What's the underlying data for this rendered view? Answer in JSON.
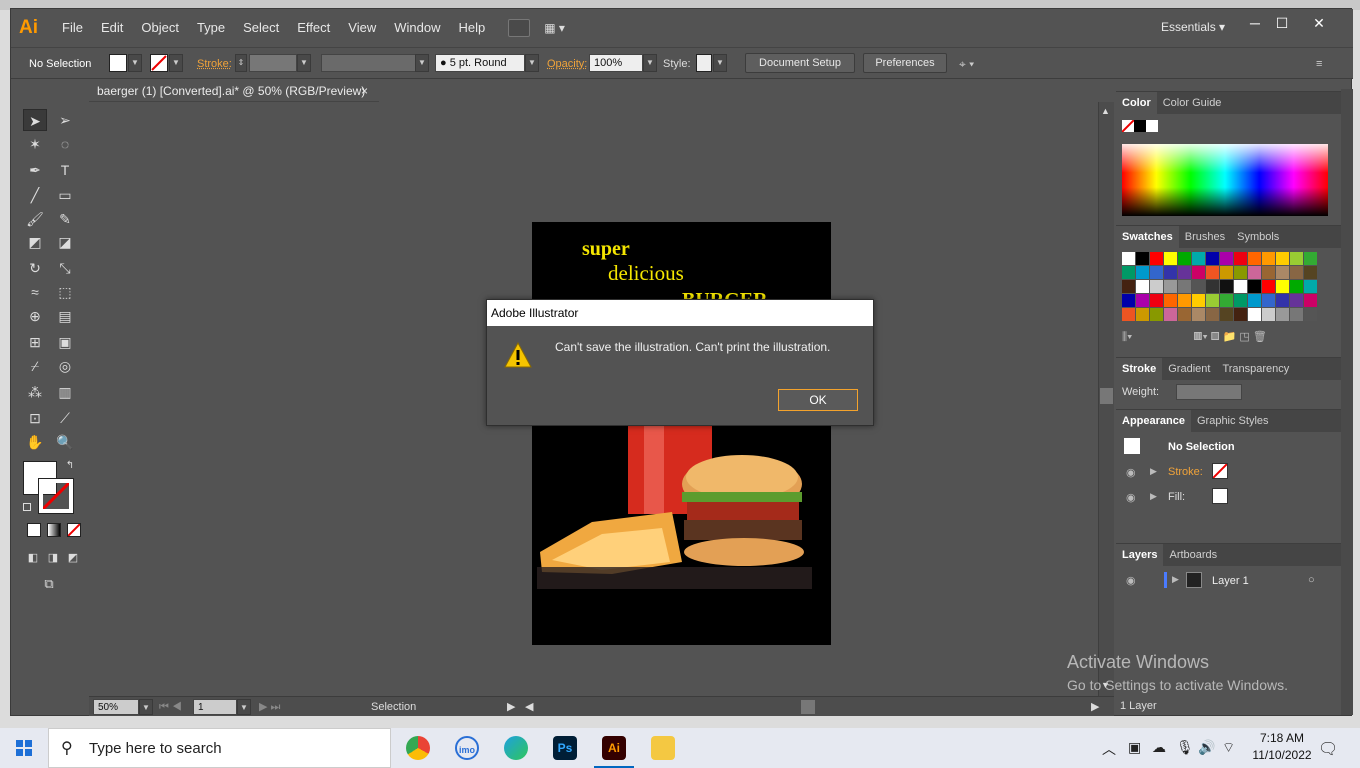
{
  "app": {
    "logo": "Ai",
    "menus": [
      "File",
      "Edit",
      "Object",
      "Type",
      "Select",
      "Effect",
      "View",
      "Window",
      "Help"
    ],
    "workspace": "Essentials",
    "window_controls": [
      "─",
      "☐",
      "✕"
    ]
  },
  "control_bar": {
    "selection": "No Selection",
    "stroke_label": "Stroke:",
    "brush": "5 pt. Round",
    "opacity_label": "Opacity:",
    "opacity_value": "100%",
    "style_label": "Style:",
    "doc_setup": "Document Setup",
    "preferences": "Preferences"
  },
  "document": {
    "tab_title": "baerger (1) [Converted].ai* @ 50% (RGB/Preview)",
    "close": "×",
    "artwork_text": [
      "super",
      "delicious",
      "BURGER"
    ]
  },
  "status": {
    "zoom": "50%",
    "page": "1",
    "mode": "Selection"
  },
  "panels": {
    "color": {
      "tabs": [
        "Color",
        "Color Guide"
      ]
    },
    "swatches": {
      "tabs": [
        "Swatches",
        "Brushes",
        "Symbols"
      ]
    },
    "stroke": {
      "tabs": [
        "Stroke",
        "Gradient",
        "Transparency"
      ],
      "weight_label": "Weight:"
    },
    "appearance": {
      "tabs": [
        "Appearance",
        "Graphic Styles"
      ],
      "title": "No Selection",
      "stroke": "Stroke:",
      "fill": "Fill:"
    },
    "layers": {
      "tabs": [
        "Layers",
        "Artboards"
      ],
      "layer_name": "Layer 1",
      "count": "1 Layer"
    }
  },
  "dialog": {
    "title": "Adobe Illustrator",
    "message": "Can't save the illustration. Can't print the illustration.",
    "ok": "OK"
  },
  "watermark": {
    "line1": "Activate Windows",
    "line2": "Go to Settings to activate Windows."
  },
  "taskbar": {
    "search_placeholder": "Type here to search",
    "time": "7:18 AM",
    "date": "11/10/2022"
  },
  "colors": {
    "accent": "#f4a32c",
    "ai_orange": "#ff9a00",
    "ui_gray": "#535353"
  }
}
